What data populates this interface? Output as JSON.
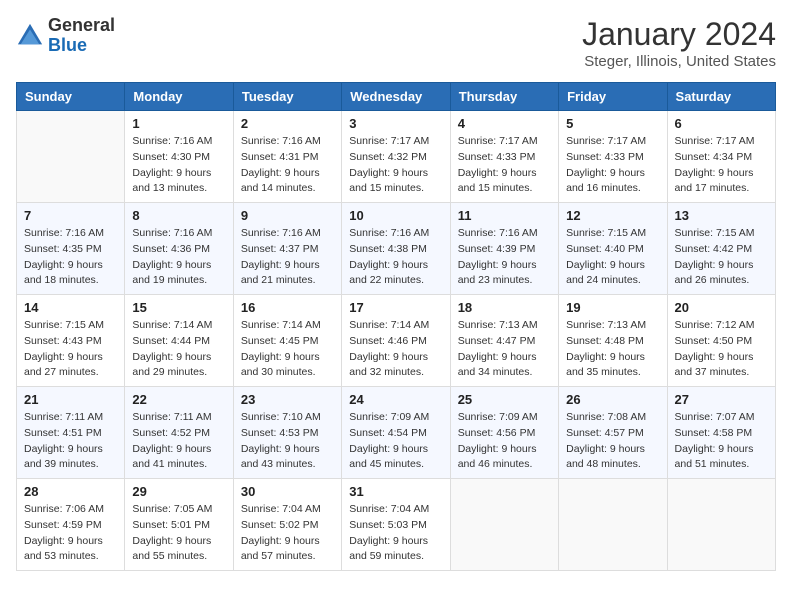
{
  "logo": {
    "text_general": "General",
    "text_blue": "Blue"
  },
  "title": "January 2024",
  "subtitle": "Steger, Illinois, United States",
  "weekdays": [
    "Sunday",
    "Monday",
    "Tuesday",
    "Wednesday",
    "Thursday",
    "Friday",
    "Saturday"
  ],
  "weeks": [
    [
      {
        "day": "",
        "info": ""
      },
      {
        "day": "1",
        "info": "Sunrise: 7:16 AM\nSunset: 4:30 PM\nDaylight: 9 hours\nand 13 minutes."
      },
      {
        "day": "2",
        "info": "Sunrise: 7:16 AM\nSunset: 4:31 PM\nDaylight: 9 hours\nand 14 minutes."
      },
      {
        "day": "3",
        "info": "Sunrise: 7:17 AM\nSunset: 4:32 PM\nDaylight: 9 hours\nand 15 minutes."
      },
      {
        "day": "4",
        "info": "Sunrise: 7:17 AM\nSunset: 4:33 PM\nDaylight: 9 hours\nand 15 minutes."
      },
      {
        "day": "5",
        "info": "Sunrise: 7:17 AM\nSunset: 4:33 PM\nDaylight: 9 hours\nand 16 minutes."
      },
      {
        "day": "6",
        "info": "Sunrise: 7:17 AM\nSunset: 4:34 PM\nDaylight: 9 hours\nand 17 minutes."
      }
    ],
    [
      {
        "day": "7",
        "info": "Sunrise: 7:16 AM\nSunset: 4:35 PM\nDaylight: 9 hours\nand 18 minutes."
      },
      {
        "day": "8",
        "info": "Sunrise: 7:16 AM\nSunset: 4:36 PM\nDaylight: 9 hours\nand 19 minutes."
      },
      {
        "day": "9",
        "info": "Sunrise: 7:16 AM\nSunset: 4:37 PM\nDaylight: 9 hours\nand 21 minutes."
      },
      {
        "day": "10",
        "info": "Sunrise: 7:16 AM\nSunset: 4:38 PM\nDaylight: 9 hours\nand 22 minutes."
      },
      {
        "day": "11",
        "info": "Sunrise: 7:16 AM\nSunset: 4:39 PM\nDaylight: 9 hours\nand 23 minutes."
      },
      {
        "day": "12",
        "info": "Sunrise: 7:15 AM\nSunset: 4:40 PM\nDaylight: 9 hours\nand 24 minutes."
      },
      {
        "day": "13",
        "info": "Sunrise: 7:15 AM\nSunset: 4:42 PM\nDaylight: 9 hours\nand 26 minutes."
      }
    ],
    [
      {
        "day": "14",
        "info": "Sunrise: 7:15 AM\nSunset: 4:43 PM\nDaylight: 9 hours\nand 27 minutes."
      },
      {
        "day": "15",
        "info": "Sunrise: 7:14 AM\nSunset: 4:44 PM\nDaylight: 9 hours\nand 29 minutes."
      },
      {
        "day": "16",
        "info": "Sunrise: 7:14 AM\nSunset: 4:45 PM\nDaylight: 9 hours\nand 30 minutes."
      },
      {
        "day": "17",
        "info": "Sunrise: 7:14 AM\nSunset: 4:46 PM\nDaylight: 9 hours\nand 32 minutes."
      },
      {
        "day": "18",
        "info": "Sunrise: 7:13 AM\nSunset: 4:47 PM\nDaylight: 9 hours\nand 34 minutes."
      },
      {
        "day": "19",
        "info": "Sunrise: 7:13 AM\nSunset: 4:48 PM\nDaylight: 9 hours\nand 35 minutes."
      },
      {
        "day": "20",
        "info": "Sunrise: 7:12 AM\nSunset: 4:50 PM\nDaylight: 9 hours\nand 37 minutes."
      }
    ],
    [
      {
        "day": "21",
        "info": "Sunrise: 7:11 AM\nSunset: 4:51 PM\nDaylight: 9 hours\nand 39 minutes."
      },
      {
        "day": "22",
        "info": "Sunrise: 7:11 AM\nSunset: 4:52 PM\nDaylight: 9 hours\nand 41 minutes."
      },
      {
        "day": "23",
        "info": "Sunrise: 7:10 AM\nSunset: 4:53 PM\nDaylight: 9 hours\nand 43 minutes."
      },
      {
        "day": "24",
        "info": "Sunrise: 7:09 AM\nSunset: 4:54 PM\nDaylight: 9 hours\nand 45 minutes."
      },
      {
        "day": "25",
        "info": "Sunrise: 7:09 AM\nSunset: 4:56 PM\nDaylight: 9 hours\nand 46 minutes."
      },
      {
        "day": "26",
        "info": "Sunrise: 7:08 AM\nSunset: 4:57 PM\nDaylight: 9 hours\nand 48 minutes."
      },
      {
        "day": "27",
        "info": "Sunrise: 7:07 AM\nSunset: 4:58 PM\nDaylight: 9 hours\nand 51 minutes."
      }
    ],
    [
      {
        "day": "28",
        "info": "Sunrise: 7:06 AM\nSunset: 4:59 PM\nDaylight: 9 hours\nand 53 minutes."
      },
      {
        "day": "29",
        "info": "Sunrise: 7:05 AM\nSunset: 5:01 PM\nDaylight: 9 hours\nand 55 minutes."
      },
      {
        "day": "30",
        "info": "Sunrise: 7:04 AM\nSunset: 5:02 PM\nDaylight: 9 hours\nand 57 minutes."
      },
      {
        "day": "31",
        "info": "Sunrise: 7:04 AM\nSunset: 5:03 PM\nDaylight: 9 hours\nand 59 minutes."
      },
      {
        "day": "",
        "info": ""
      },
      {
        "day": "",
        "info": ""
      },
      {
        "day": "",
        "info": ""
      }
    ]
  ]
}
